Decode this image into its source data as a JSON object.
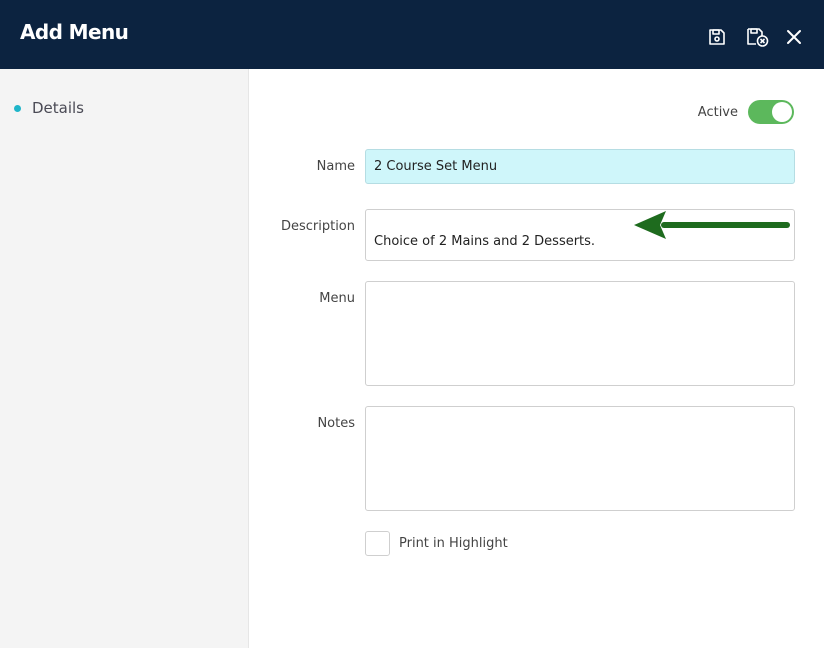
{
  "header": {
    "title": "Add Menu",
    "buttons": [
      {
        "name": "save",
        "icon": "floppy-disk-icon"
      },
      {
        "name": "save-and-close",
        "icon": "floppy-disk-close-icon"
      },
      {
        "name": "close",
        "icon": "close-icon"
      }
    ]
  },
  "sidebar": {
    "items": [
      {
        "label": "Details",
        "active": true
      }
    ]
  },
  "form": {
    "active_label": "Active",
    "active_value": true,
    "name_label": "Name",
    "name_value": "2 Course Set Menu",
    "description_label": "Description",
    "description_value": "Choice of 2 Mains and 2 Desserts.",
    "menu_label": "Menu",
    "menu_value": "",
    "notes_label": "Notes",
    "notes_value": "",
    "print_label": "Print in Highlight",
    "print_checked": false
  },
  "annotation": {
    "type": "arrow",
    "color": "#1e6b1e",
    "points_to": "description"
  },
  "colors": {
    "header_bg": "#0c2340",
    "sidebar_bg": "#f4f4f4",
    "accent_dot": "#1fb5c9",
    "toggle_on": "#5cb85c",
    "highlight_input": "#cff6fa"
  }
}
